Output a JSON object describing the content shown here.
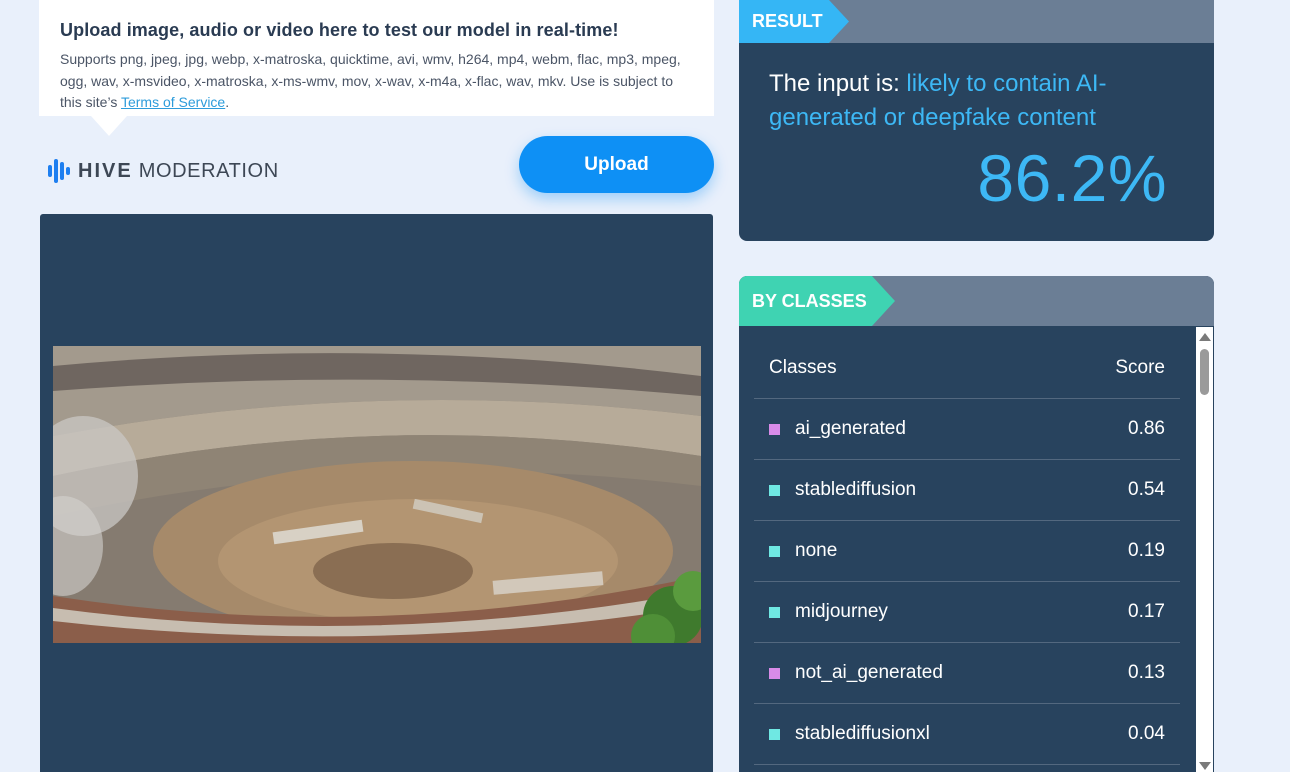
{
  "upload_card": {
    "title": "Upload image, audio or video here to test our model in real-time!",
    "supported_text": "Supports png, jpeg, jpg, webp, x-matroska, quicktime, avi, wmv, h264, mp4, webm, flac, mp3, mpeg, ogg, wav, x-msvideo, x-matroska, x-ms-wmv, mov, x-wav, x-m4a, x-flac, wav, mkv. Use is subject to this site’s ",
    "terms_link": "Terms of Service",
    "terms_suffix": "."
  },
  "logo": {
    "brand": "HIVE",
    "product": "MODERATION",
    "icon": "hive-bars-icon"
  },
  "upload_button": {
    "label": "Upload"
  },
  "preview": {
    "image_desc_icon": "uploaded-image"
  },
  "result": {
    "tag": "RESULT",
    "prefix": "The input is: ",
    "verdict": "likely to contain AI-generated or deepfake content",
    "score": "86.2%"
  },
  "classes": {
    "tag": "BY CLASSES",
    "header": {
      "classes": "Classes",
      "score": "Score"
    },
    "rows": [
      {
        "name": "ai_generated",
        "score": "0.86",
        "color": "#d88be8"
      },
      {
        "name": "stablediffusion",
        "score": "0.54",
        "color": "#6fe8e3"
      },
      {
        "name": "none",
        "score": "0.19",
        "color": "#6fe8e3"
      },
      {
        "name": "midjourney",
        "score": "0.17",
        "color": "#6fe8e3"
      },
      {
        "name": "not_ai_generated",
        "score": "0.13",
        "color": "#d88be8"
      },
      {
        "name": "stablediffusionxl",
        "score": "0.04",
        "color": "#6fe8e3"
      }
    ]
  },
  "colors": {
    "accent_blue": "#35b6f5",
    "accent_teal": "#3fd3b2",
    "panel": "#28435e",
    "button": "#0e90f5"
  }
}
